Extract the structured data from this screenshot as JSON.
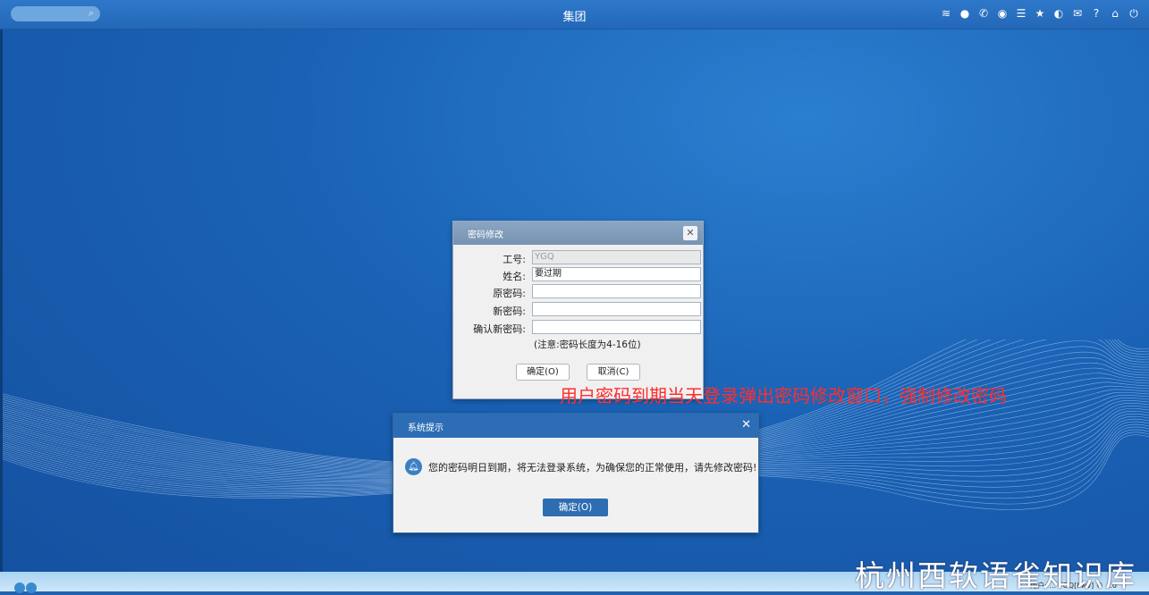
{
  "topbar": {
    "title": "集团",
    "search_icon": "search-icon",
    "icons": [
      "wifi-icon",
      "chat-icon",
      "phone-icon",
      "palette-icon",
      "list-icon",
      "star-icon",
      "moon-icon",
      "mail-icon",
      "help-icon",
      "home-icon",
      "power-icon"
    ]
  },
  "password_dialog": {
    "title": "密码修改",
    "fields": [
      {
        "label": "工号:",
        "value": "YGQ"
      },
      {
        "label": "姓名:",
        "value": "要过期"
      },
      {
        "label": "原密码:",
        "value": ""
      },
      {
        "label": "新密码:",
        "value": ""
      },
      {
        "label": "确认新密码:",
        "value": ""
      }
    ],
    "note": "(注意:密码长度为4-16位)",
    "ok_label": "确定(O)",
    "cancel_label": "取消(C)"
  },
  "annotation": "用户密码到期当天登录弹出密码修改窗口，强制修改密码",
  "system_dialog": {
    "title": "系统提示",
    "message": "您的密码明日到期，将无法登录系统，为确保您的正常使用，请先修改密码!",
    "ok_label": "确定(O)"
  },
  "watermark": "杭州西软语雀知识库",
  "taskbar": {
    "status_text": "用户: ...  YGQ[Ilwv] ©  ...0"
  },
  "colors": {
    "accent": "#2c6db6",
    "annotation": "#ff2e2e",
    "desktop": "#1a62b5"
  }
}
